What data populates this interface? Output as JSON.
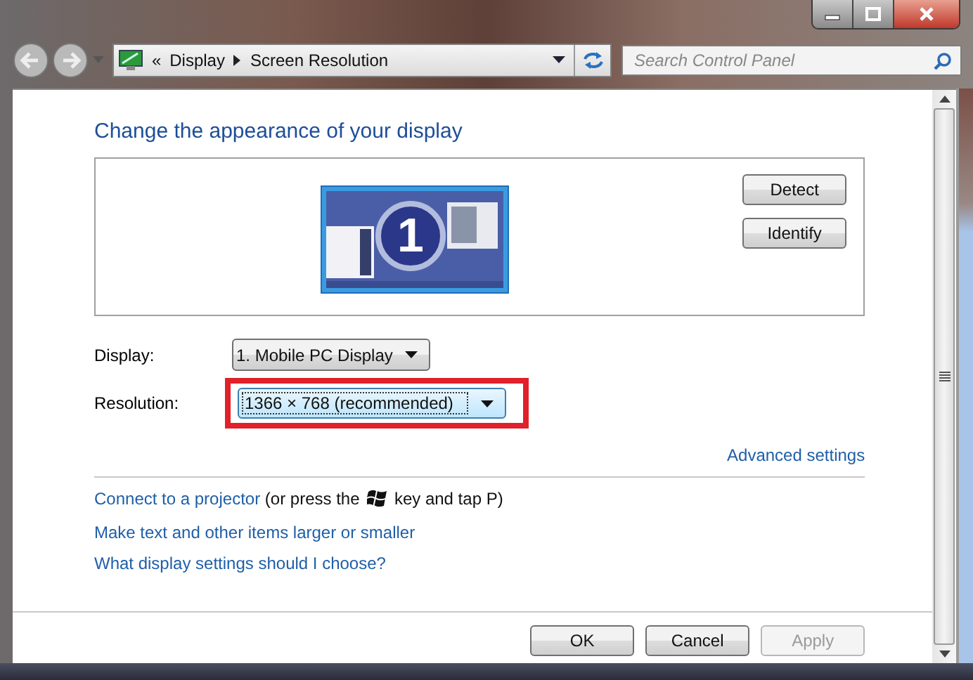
{
  "address_bar": {
    "overflow": "«",
    "breadcrumbs": [
      "Display",
      "Screen Resolution"
    ]
  },
  "search": {
    "placeholder": "Search Control Panel"
  },
  "heading": "Change the appearance of your display",
  "preview": {
    "display_number": "1",
    "buttons": [
      "Detect",
      "Identify"
    ]
  },
  "fields": [
    {
      "label": "Display:",
      "value": "1. Mobile PC Display",
      "highlighted": false
    },
    {
      "label": "Resolution:",
      "value": "1366 × 768 (recommended)",
      "highlighted": true
    }
  ],
  "advanced_link": "Advanced settings",
  "projector": {
    "link": "Connect to a projector",
    "before_key": "(or press the",
    "after_key": "key and tap P)"
  },
  "links": [
    "Make text and other items larger or smaller",
    "What display settings should I choose?"
  ],
  "footer_buttons": [
    {
      "label": "OK",
      "disabled": false
    },
    {
      "label": "Cancel",
      "disabled": false
    },
    {
      "label": "Apply",
      "disabled": true
    }
  ]
}
